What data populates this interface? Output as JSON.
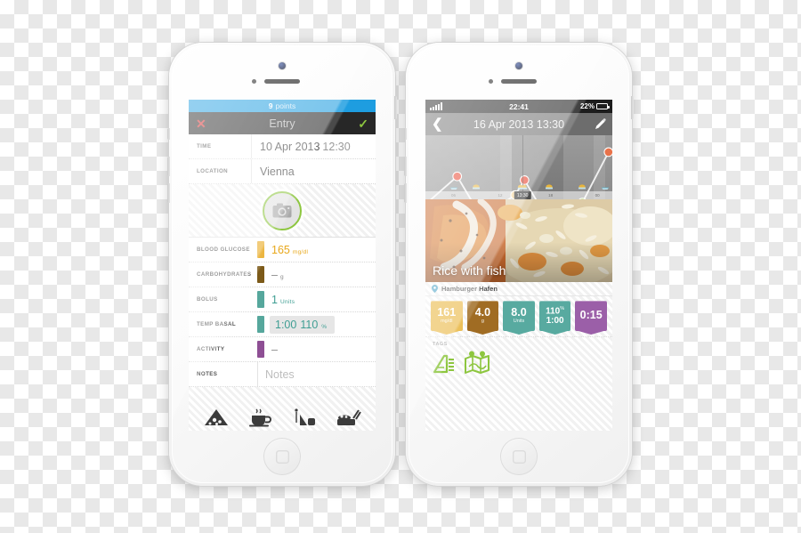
{
  "left_phone": {
    "points_banner": {
      "count": "9",
      "label": "points"
    },
    "navbar": {
      "title": "Entry",
      "cancel_icon": "x-icon",
      "confirm_icon": "check-icon"
    },
    "rows": [
      {
        "label": "TIME",
        "value": "10 Apr 2013",
        "value2": "12:30",
        "swatch": ""
      },
      {
        "label": "LOCATION",
        "value": "Vienna",
        "value2": "",
        "swatch": ""
      }
    ],
    "camera_button": "camera-icon",
    "metrics": [
      {
        "label": "BLOOD GLUCOSE",
        "value": "165",
        "unit": "mg/dl",
        "color": "#e8a81c",
        "text_color": "#e8a81c"
      },
      {
        "label": "CARBOHYDRATES",
        "value": "–",
        "unit": "g",
        "color": "#7c5a19",
        "text_color": "#8a8a8a"
      },
      {
        "label": "BOLUS",
        "value": "1",
        "unit": "Units",
        "color": "#56a79c",
        "text_color": "#3f9e93"
      },
      {
        "label": "TEMP BASAL",
        "value": "1:00",
        "unit": "110",
        "unit2": "%",
        "color": "#56a79c",
        "text_color": "#3f9e93"
      },
      {
        "label": "ACTIVITY",
        "value": "–",
        "unit": "",
        "color": "#8e4f94",
        "text_color": "#8a8a8a"
      },
      {
        "label": "NOTES",
        "value": "",
        "placeholder": "Notes",
        "unit": "",
        "color": "",
        "text_color": "#bdbdbd"
      }
    ],
    "food_icons": [
      "pizza-slice-icon",
      "coffee-cup-icon",
      "drink-icon",
      "meal-tray-icon"
    ]
  },
  "right_phone": {
    "status_bar": {
      "signal_icon": "signal-bars-icon",
      "time": "22:41",
      "battery_percent": "22%",
      "battery_icon": "battery-icon"
    },
    "navbar": {
      "back_icon": "back-chevron-icon",
      "title": "16 Apr 2013 13:30",
      "edit_icon": "pencil-icon"
    },
    "photo": {
      "caption": "Rice with fish"
    },
    "location": {
      "pin_icon": "map-pin-icon",
      "name": "Hamburger Hafen"
    },
    "chips": [
      {
        "value": "161",
        "unit": "mg/dl",
        "color": "#e8b43a"
      },
      {
        "value": "4.0",
        "unit": "g",
        "color": "#a06c23"
      },
      {
        "value": "8.0",
        "unit": "Units",
        "color": "#58aaa0"
      },
      {
        "value": "110",
        "unit": "%",
        "value2": "1:00",
        "color": "#58aaa0",
        "dual": true
      },
      {
        "value": "0:15",
        "unit": "",
        "color": "#9b5fa8"
      }
    ],
    "tags": {
      "label": "TAGS",
      "items": [
        "escalator-icon",
        "map-route-icon"
      ]
    },
    "chart_data": {
      "type": "line",
      "title": "",
      "xlabel": "",
      "ylabel": "",
      "cursor_label": "13:30",
      "x_ticks": [
        "06",
        "12",
        "18",
        "00"
      ],
      "points": [
        {
          "x": 0,
          "y": 52,
          "color": "#cfcfcf"
        },
        {
          "x": 17,
          "y": 30,
          "color": "#e8402a"
        },
        {
          "x": 30,
          "y": 62,
          "color": "#7fc326"
        },
        {
          "x": 48,
          "y": 44,
          "color": "#f0a91e"
        },
        {
          "x": 53,
          "y": 33,
          "color": "#e8402a"
        },
        {
          "x": 66,
          "y": 65,
          "color": "#7fc326"
        },
        {
          "x": 84,
          "y": 50,
          "color": "#7fc326"
        },
        {
          "x": 98,
          "y": 12,
          "color": "#e8724a"
        }
      ],
      "meal_marks": [
        15,
        27,
        47,
        53,
        66,
        84
      ]
    }
  }
}
